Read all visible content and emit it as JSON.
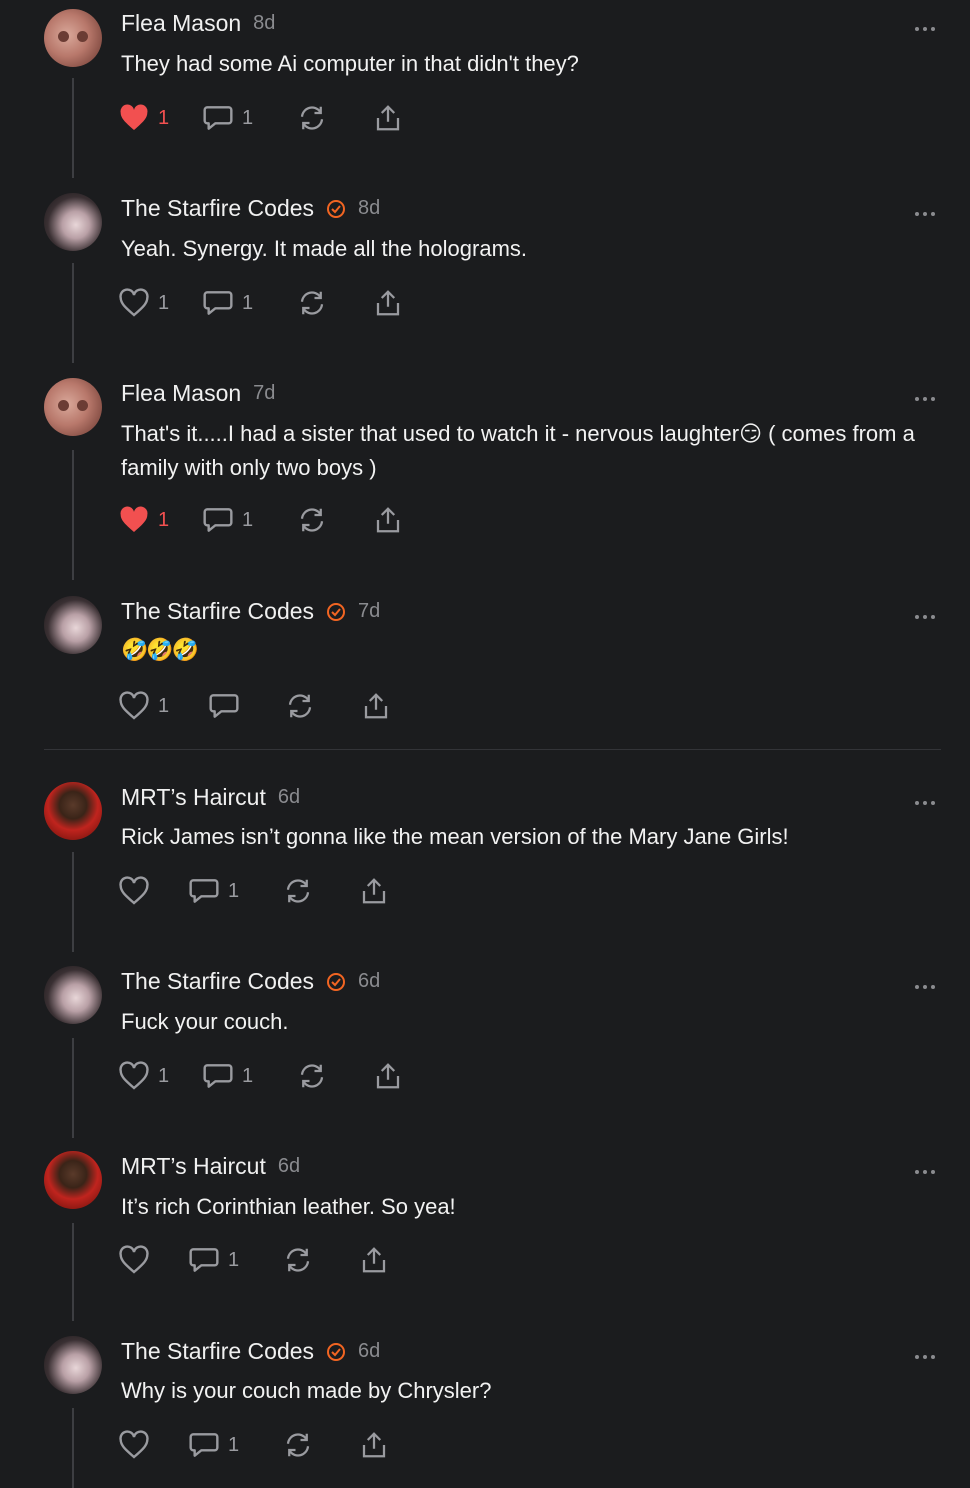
{
  "comments": [
    {
      "author": "Flea Mason",
      "verified": false,
      "time": "8d",
      "text": "They had some Ai computer in that didn't they?",
      "liked": true,
      "likes": "1",
      "replies": "1",
      "avatar": "flea"
    },
    {
      "author": "The Starfire Codes",
      "verified": true,
      "time": "8d",
      "text": "Yeah. Synergy. It made all the holograms.",
      "liked": false,
      "likes": "1",
      "replies": "1",
      "avatar": "star"
    },
    {
      "author": "Flea Mason",
      "verified": false,
      "time": "7d",
      "text": "That's it.....I had a sister that used to watch it - nervous laughter😏 ( comes from a family with only two boys )",
      "liked": true,
      "likes": "1",
      "replies": "1",
      "avatar": "flea"
    },
    {
      "author": "The Starfire Codes",
      "verified": true,
      "time": "7d",
      "text": "🤣🤣🤣",
      "liked": false,
      "likes": "1",
      "replies": "",
      "avatar": "star"
    },
    {
      "author": "MRT’s Haircut",
      "verified": false,
      "time": "6d",
      "text": "Rick James isn’t gonna like the mean version of the Mary Jane Girls!",
      "liked": false,
      "likes": "",
      "replies": "1",
      "avatar": "mrt"
    },
    {
      "author": "The Starfire Codes",
      "verified": true,
      "time": "6d",
      "text": "Fuck your couch.",
      "liked": false,
      "likes": "1",
      "replies": "1",
      "avatar": "star"
    },
    {
      "author": "MRT’s Haircut",
      "verified": false,
      "time": "6d",
      "text": "It’s rich Corinthian leather. So yea!",
      "liked": false,
      "likes": "",
      "replies": "1",
      "avatar": "mrt"
    },
    {
      "author": "The Starfire Codes",
      "verified": true,
      "time": "6d",
      "text": "Why is your couch made by Chrysler?",
      "liked": false,
      "likes": "",
      "replies": "1",
      "avatar": "star"
    }
  ],
  "colors": {
    "background": "#1b1c1e",
    "accent": "#f26522",
    "like": "#f25050",
    "muted": "#9a9ba0"
  },
  "icons": [
    "heart-icon",
    "comment-icon",
    "restack-icon",
    "share-icon",
    "more-icon",
    "verified-check-icon"
  ]
}
